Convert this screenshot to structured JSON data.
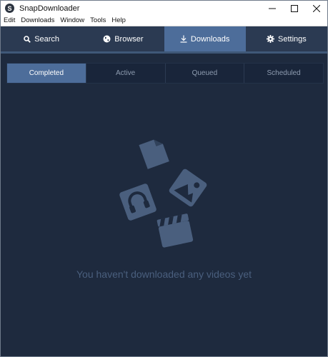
{
  "window": {
    "title": "SnapDownloader",
    "app_icon_glyph": "S"
  },
  "menu": [
    "Edit",
    "Downloads",
    "Window",
    "Tools",
    "Help"
  ],
  "tabs": [
    {
      "label": "Search",
      "icon": "search-icon",
      "active": false
    },
    {
      "label": "Browser",
      "icon": "globe-icon",
      "active": false
    },
    {
      "label": "Downloads",
      "icon": "download-icon",
      "active": true
    },
    {
      "label": "Settings",
      "icon": "gear-icon",
      "active": false
    }
  ],
  "subtabs": [
    {
      "label": "Completed",
      "active": true
    },
    {
      "label": "Active",
      "active": false
    },
    {
      "label": "Queued",
      "active": false
    },
    {
      "label": "Scheduled",
      "active": false
    }
  ],
  "empty_state": {
    "message": "You haven't downloaded any videos yet",
    "icons": [
      "document-icon",
      "image-icon",
      "audio-icon",
      "video-icon"
    ]
  },
  "colors": {
    "background": "#1e2a3e",
    "tab_bar": "#2b3a52",
    "active_tab": "#4d6d9a",
    "illustration": "#4a5f7e"
  }
}
